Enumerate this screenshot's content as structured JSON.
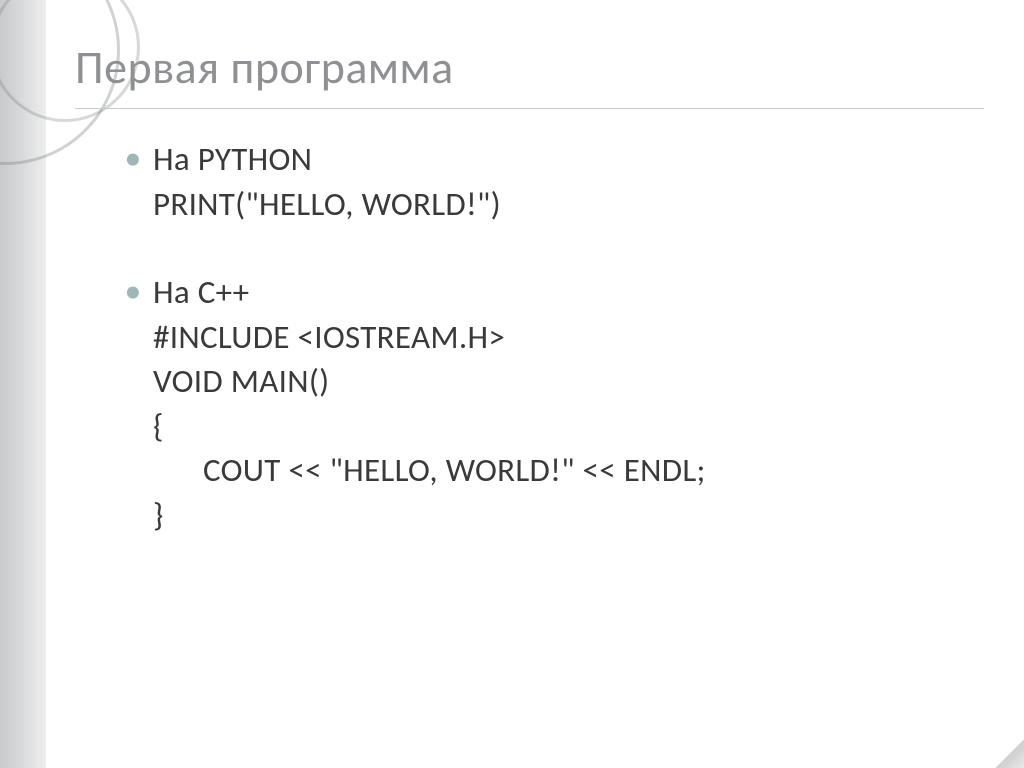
{
  "title": "Первая программа",
  "bullets": [
    {
      "heading": "На PYTHON",
      "lines": [
        "PRINT(\"HELLO, WORLD!\")"
      ]
    },
    {
      "heading": "На C++",
      "lines": [
        "#INCLUDE <IOSTREAM.H>",
        "VOID MAIN()",
        "{",
        "COUT << \"HELLO, WORLD!\" << ENDL;",
        "}"
      ],
      "indent_extra": [
        3
      ]
    }
  ]
}
